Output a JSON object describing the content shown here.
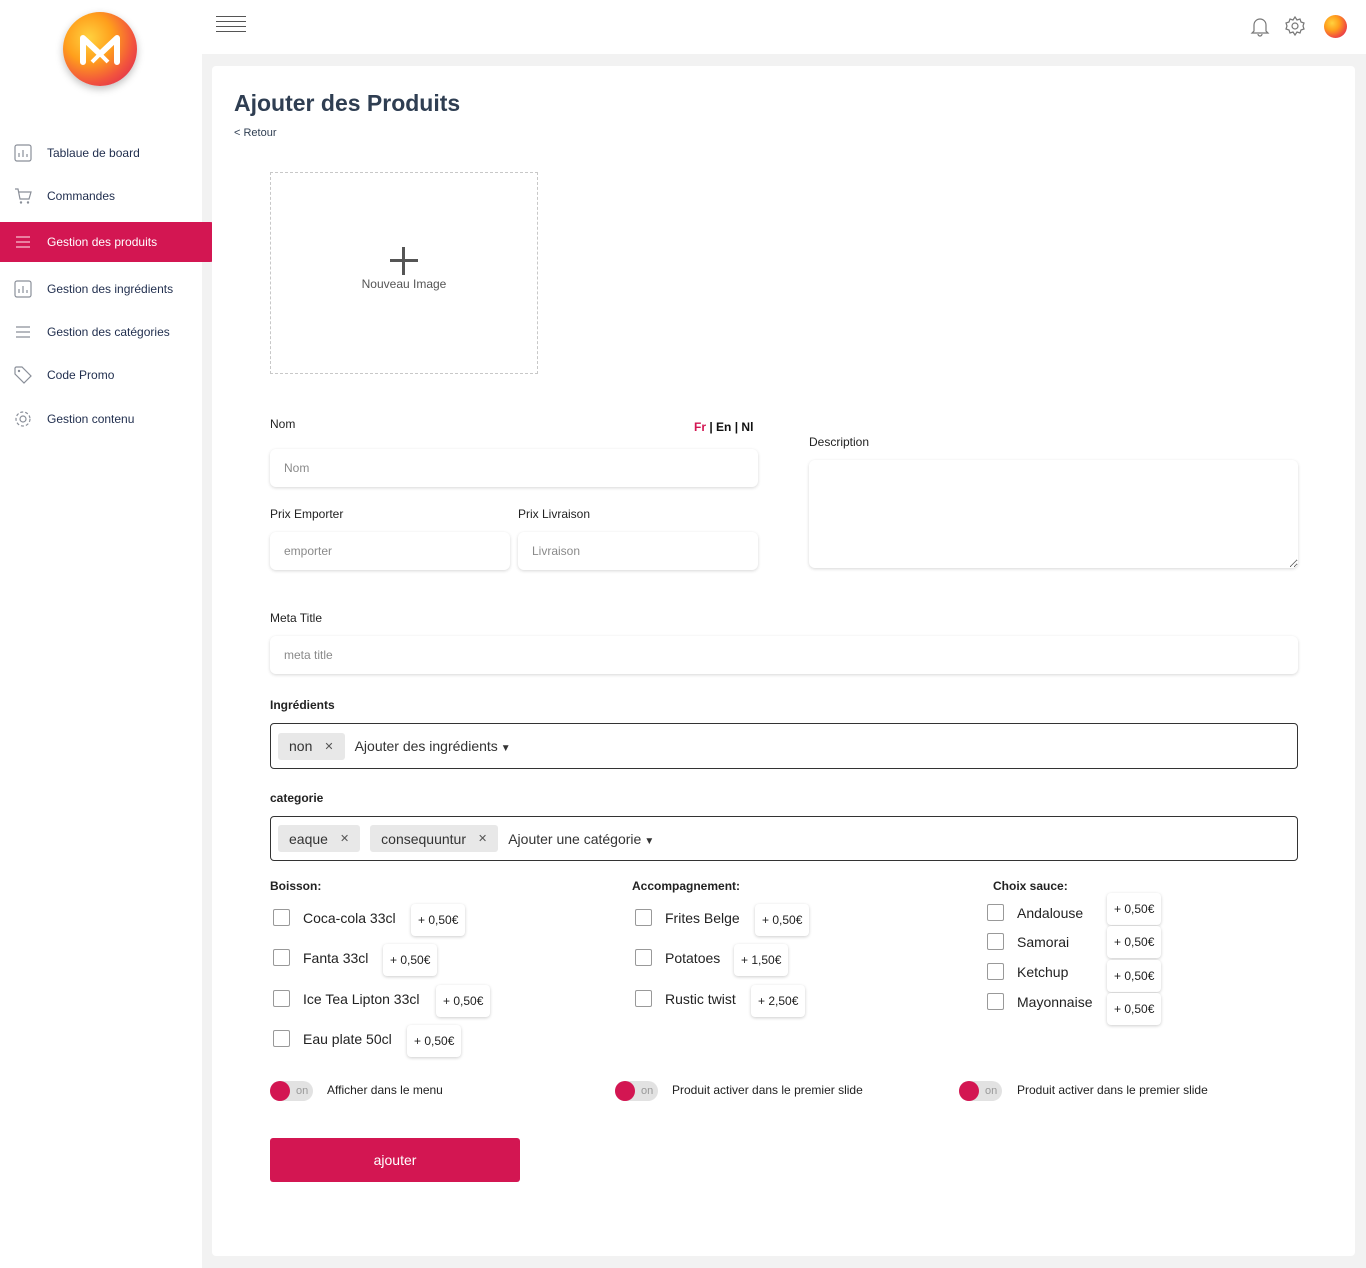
{
  "sidebar": {
    "items": [
      {
        "label": "Tablaue de board",
        "icon": "chart-icon"
      },
      {
        "label": "Commandes",
        "icon": "cart-icon"
      },
      {
        "label": "Gestion des produits",
        "icon": "list-icon",
        "active": true
      },
      {
        "label": "Gestion des ingrédients",
        "icon": "chart-icon"
      },
      {
        "label": "Gestion des catégories",
        "icon": "list-icon"
      },
      {
        "label": "Code Promo",
        "icon": "tag-icon"
      },
      {
        "label": "Gestion contenu",
        "icon": "gear-icon"
      }
    ]
  },
  "header": {
    "icons": [
      "menu-icon",
      "bell-icon",
      "gear-icon",
      "avatar"
    ]
  },
  "page": {
    "title": "Ajouter des Produits",
    "back": "< Retour"
  },
  "upload": {
    "label": "Nouveau Image"
  },
  "form": {
    "nom": {
      "label": "Nom",
      "placeholder": "Nom"
    },
    "langs": {
      "fr": "Fr",
      "sep": " | ",
      "en": "En",
      "nl": "Nl"
    },
    "prix_emporter": {
      "label": "Prix Emporter",
      "placeholder": "emporter"
    },
    "prix_livraison": {
      "label": "Prix Livraison",
      "placeholder": "Livraison"
    },
    "description": {
      "label": "Description",
      "placeholder": ""
    },
    "meta_title": {
      "label": "Meta Title",
      "placeholder": "meta title"
    },
    "ingredients": {
      "label": "Ingrédients",
      "tags": [
        "non"
      ],
      "dropdown": "Ajouter des ingrédients"
    },
    "categorie": {
      "label": "categorie",
      "tags": [
        "eaque",
        "consequuntur"
      ],
      "dropdown": "Ajouter une catégorie"
    }
  },
  "options": {
    "boisson": {
      "title": "Boisson:",
      "items": [
        {
          "label": "Coca-cola 33cl",
          "price": "+ 0,50€"
        },
        {
          "label": "Fanta 33cl",
          "price": "+ 0,50€"
        },
        {
          "label": "Ice Tea Lipton 33cl",
          "price": "+ 0,50€"
        },
        {
          "label": "Eau plate 50cl",
          "price": "+ 0,50€"
        }
      ]
    },
    "accompagnement": {
      "title": "Accompagnement:",
      "items": [
        {
          "label": "Frites Belge",
          "price": "+ 0,50€"
        },
        {
          "label": "Potatoes",
          "price": "+ 1,50€"
        },
        {
          "label": "Rustic twist",
          "price": "+ 2,50€"
        }
      ]
    },
    "sauce": {
      "title": "Choix sauce:",
      "items": [
        {
          "label": "Andalouse",
          "price": "+ 0,50€"
        },
        {
          "label": "Samorai",
          "price": "+ 0,50€"
        },
        {
          "label": "Ketchup",
          "price": "+ 0,50€"
        },
        {
          "label": "Mayonnaise",
          "price": "+ 0,50€"
        }
      ]
    }
  },
  "toggles": [
    {
      "state": "on",
      "label": "Afficher dans le menu"
    },
    {
      "state": "on",
      "label": "Produit activer dans le premier slide"
    },
    {
      "state": "on",
      "label": "Produit activer dans le premier slide"
    }
  ],
  "submit": {
    "label": "ajouter"
  },
  "colors": {
    "accent": "#d31652",
    "text": "#1f2d4d"
  }
}
